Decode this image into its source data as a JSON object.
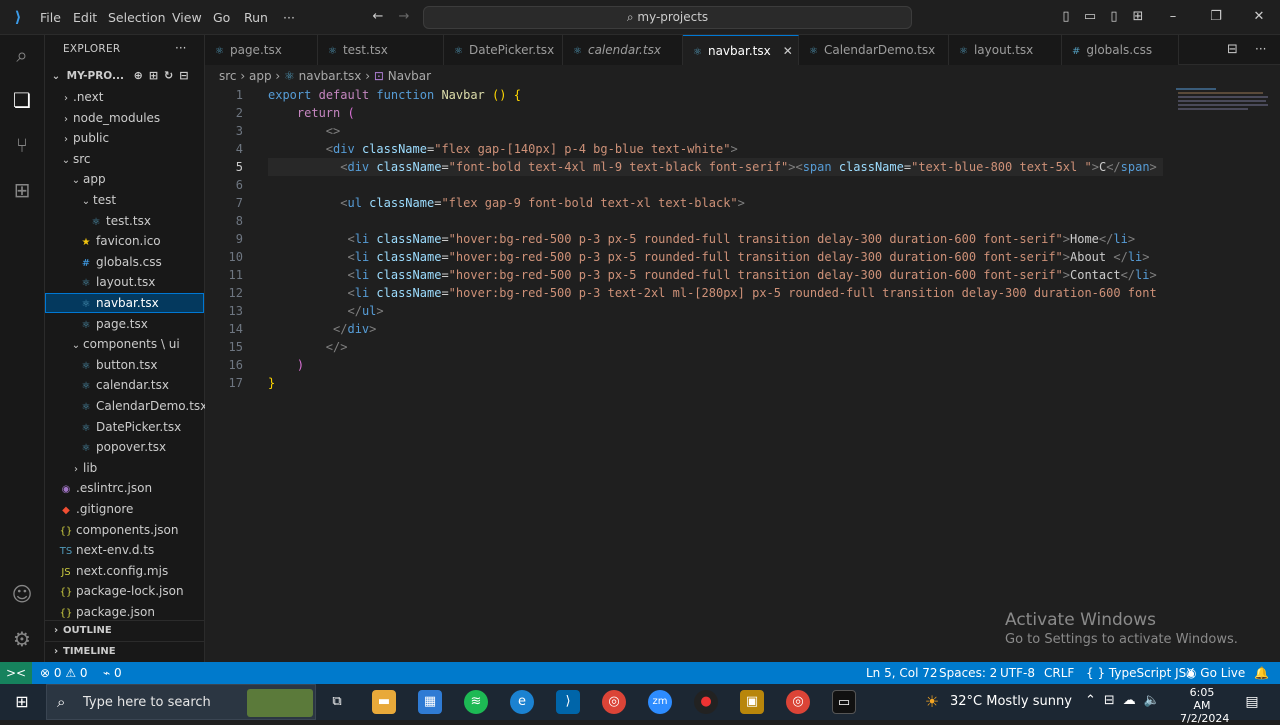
{
  "titlebar": {
    "menu": [
      "File",
      "Edit",
      "Selection",
      "View",
      "Go",
      "Run",
      "···"
    ],
    "search_text": "my-projects"
  },
  "explorer": {
    "title": "EXPLORER",
    "root": "MY-PRO...",
    "tree": [
      {
        "label": ".next",
        "type": "folder",
        "depth": 1,
        "open": false
      },
      {
        "label": "node_modules",
        "type": "folder",
        "depth": 1,
        "open": false
      },
      {
        "label": "public",
        "type": "folder",
        "depth": 1,
        "open": false
      },
      {
        "label": "src",
        "type": "folder",
        "depth": 1,
        "open": true
      },
      {
        "label": "app",
        "type": "folder",
        "depth": 2,
        "open": true
      },
      {
        "label": "test",
        "type": "folder",
        "depth": 3,
        "open": true
      },
      {
        "label": "test.tsx",
        "type": "react",
        "depth": 4
      },
      {
        "label": "favicon.ico",
        "type": "star",
        "depth": 3
      },
      {
        "label": "globals.css",
        "type": "css",
        "depth": 3
      },
      {
        "label": "layout.tsx",
        "type": "react",
        "depth": 3
      },
      {
        "label": "navbar.tsx",
        "type": "react",
        "depth": 3,
        "selected": true
      },
      {
        "label": "page.tsx",
        "type": "react",
        "depth": 3
      },
      {
        "label": "components \\ ui",
        "type": "folder",
        "depth": 2,
        "open": true
      },
      {
        "label": "button.tsx",
        "type": "react",
        "depth": 3
      },
      {
        "label": "calendar.tsx",
        "type": "react",
        "depth": 3
      },
      {
        "label": "CalendarDemo.tsx",
        "type": "react",
        "depth": 3
      },
      {
        "label": "DatePicker.tsx",
        "type": "react",
        "depth": 3
      },
      {
        "label": "popover.tsx",
        "type": "react",
        "depth": 3
      },
      {
        "label": "lib",
        "type": "folder",
        "depth": 2,
        "open": false
      },
      {
        "label": ".eslintrc.json",
        "type": "eslint",
        "depth": 1
      },
      {
        "label": ".gitignore",
        "type": "git",
        "depth": 1
      },
      {
        "label": "components.json",
        "type": "json",
        "depth": 1
      },
      {
        "label": "next-env.d.ts",
        "type": "ts",
        "depth": 1
      },
      {
        "label": "next.config.mjs",
        "type": "js",
        "depth": 1
      },
      {
        "label": "package-lock.json",
        "type": "json",
        "depth": 1
      },
      {
        "label": "package.json",
        "type": "json",
        "depth": 1
      }
    ],
    "outline": "OUTLINE",
    "timeline": "TIMELINE"
  },
  "tabs": [
    {
      "label": "page.tsx"
    },
    {
      "label": "test.tsx"
    },
    {
      "label": "DatePicker.tsx"
    },
    {
      "label": "calendar.tsx",
      "italic": true
    },
    {
      "label": "navbar.tsx",
      "active": true
    },
    {
      "label": "CalendarDemo.tsx"
    },
    {
      "label": "layout.tsx"
    },
    {
      "label": "globals.css"
    }
  ],
  "breadcrumb": [
    "src",
    "app",
    "navbar.tsx",
    "Navbar"
  ],
  "status": {
    "remote": "><",
    "problems": "⊗ 0 ⚠ 0",
    "ports": "⌁ 0",
    "position": "Ln 5, Col 72",
    "spaces": "Spaces: 2",
    "encoding": "UTF-8",
    "eol": "CRLF",
    "language": "TypeScript JSX",
    "golive": "Go Live"
  },
  "watermark": {
    "title": "Activate Windows",
    "subtitle": "Go to Settings to activate Windows."
  },
  "taskbar": {
    "search_placeholder": "Type here to search",
    "weather": "32°C  Mostly sunny",
    "time": "6:05 AM",
    "date": "7/2/2024"
  },
  "colors": {
    "accent": "#007acc",
    "selection": "#04395e"
  }
}
